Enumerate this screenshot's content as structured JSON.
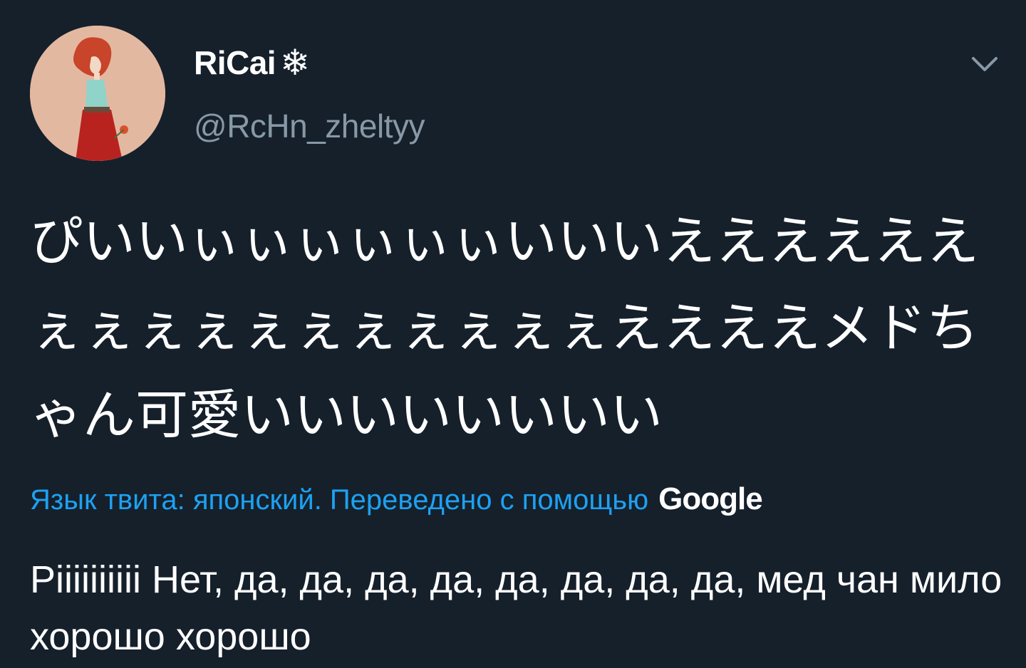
{
  "author": {
    "display_name": "RiCai",
    "emoji": "❄",
    "handle": "@RcHn_zheltyy"
  },
  "tweet": {
    "text": "ぴいいぃぃぃぃぃぃいいいええええええぇぇぇぇぇぇぇぇぇぇぇええええメドちゃん可愛いいいいいいいい"
  },
  "translation": {
    "notice": "Язык твита: японский. Переведено с помощью",
    "provider": "Google",
    "text": "Piiiiiiiiii Нет, да, да, да, да, да, да, да, да, мед чан мило хорошо хорошо"
  },
  "colors": {
    "background": "#15202b",
    "link": "#1da1f2",
    "secondary": "#8899a6"
  },
  "icons": {
    "menu": "chevron-down-icon",
    "avatar": "avatar-illustration"
  }
}
